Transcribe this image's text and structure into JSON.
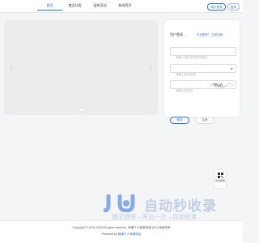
{
  "nav": {
    "items": [
      {
        "label": "首页",
        "active": true
      },
      {
        "label": "商品分类",
        "active": false
      },
      {
        "label": "促销活动",
        "active": false
      },
      {
        "label": "新闻资讯",
        "active": false
      }
    ]
  },
  "header": {
    "merchant_label": "商户登录",
    "login_label": "登录"
  },
  "login": {
    "title": "用户登录",
    "tip": "忘记密码？ 立即注册！",
    "username_placeholder": "请输入您的手机号或账号",
    "password_placeholder": "请输入登录密码",
    "captcha_placeholder": "请输入验证码",
    "captcha_text": "7b2h",
    "login_button": "登录",
    "register_button": "注册"
  },
  "side_tool": {
    "label": "在线客服"
  },
  "watermark": {
    "main": "自动秒收录",
    "sub": "提交链接→来访一次→自动收录"
  },
  "footer": {
    "copyright": "Copyright © 2018-2025 All rights reserved. 商通个人商家系统 (PC) 版权所有",
    "powered_prefix": "Powered by",
    "powered_link": "商通个人商家网站"
  },
  "colors": {
    "accent": "#2f6fd8",
    "background": "#f4f5f7"
  }
}
